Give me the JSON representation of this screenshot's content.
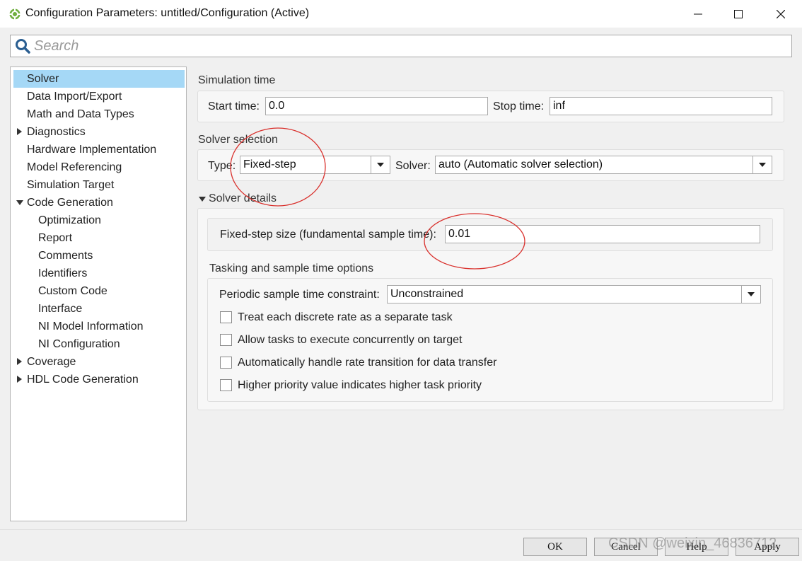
{
  "window": {
    "title": "Configuration Parameters: untitled/Configuration (Active)"
  },
  "search": {
    "placeholder": "Search"
  },
  "tree": {
    "items": [
      {
        "label": "Solver"
      },
      {
        "label": "Data Import/Export"
      },
      {
        "label": "Math and Data Types"
      },
      {
        "label": "Diagnostics"
      },
      {
        "label": "Hardware Implementation"
      },
      {
        "label": "Model Referencing"
      },
      {
        "label": "Simulation Target"
      },
      {
        "label": "Code Generation"
      },
      {
        "label": "Optimization"
      },
      {
        "label": "Report"
      },
      {
        "label": "Comments"
      },
      {
        "label": "Identifiers"
      },
      {
        "label": "Custom Code"
      },
      {
        "label": "Interface"
      },
      {
        "label": "NI Model Information"
      },
      {
        "label": "NI Configuration"
      },
      {
        "label": "Coverage"
      },
      {
        "label": "HDL Code Generation"
      }
    ]
  },
  "simulation_time": {
    "title": "Simulation time",
    "start_label": "Start time:",
    "start_value": "0.0",
    "stop_label": "Stop time:",
    "stop_value": "inf"
  },
  "solver_selection": {
    "title": "Solver selection",
    "type_label": "Type:",
    "type_value": "Fixed-step",
    "solver_label": "Solver:",
    "solver_value": "auto (Automatic solver selection)"
  },
  "solver_details": {
    "title": "Solver details",
    "step_label": "Fixed-step size (fundamental sample time):",
    "step_value": "0.01"
  },
  "tasking": {
    "title": "Tasking and sample time options",
    "constraint_label": "Periodic sample time constraint:",
    "constraint_value": "Unconstrained",
    "checkboxes": [
      {
        "label": "Treat each discrete rate as a separate task",
        "checked": false
      },
      {
        "label": "Allow tasks to execute concurrently on target",
        "checked": false
      },
      {
        "label": "Automatically handle rate transition for data transfer",
        "checked": false
      },
      {
        "label": "Higher priority value indicates higher task priority",
        "checked": false
      }
    ]
  },
  "buttons": {
    "ok": "OK",
    "cancel": "Cancel",
    "help": "Help",
    "apply": "Apply"
  },
  "watermark": "CSDN @weixin_46836712",
  "colors": {
    "selection": "#a5d8f6",
    "annotation": "#d9302c"
  },
  "icons": [
    "simulink-app-icon",
    "minimize-icon",
    "maximize-icon",
    "close-icon",
    "search-icon"
  ]
}
